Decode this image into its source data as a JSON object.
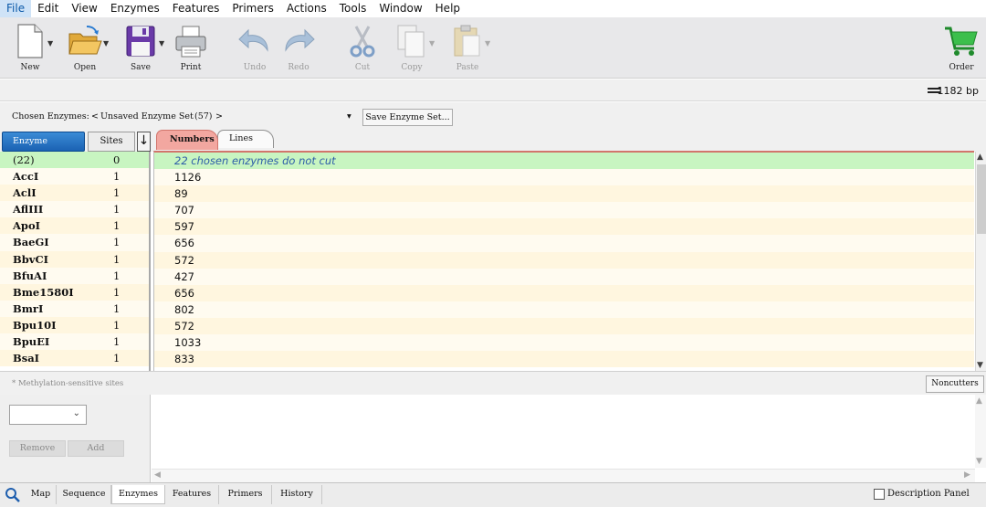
{
  "menu": {
    "items": [
      "File",
      "Edit",
      "View",
      "Enzymes",
      "Features",
      "Primers",
      "Actions",
      "Tools",
      "Window",
      "Help"
    ]
  },
  "toolbar": {
    "new": "New",
    "open": "Open",
    "save": "Save",
    "print": "Print",
    "undo": "Undo",
    "redo": "Redo",
    "cut": "Cut",
    "copy": "Copy",
    "paste": "Paste",
    "order": "Order"
  },
  "sequence": {
    "length": "1182 bp"
  },
  "enzyme_set": {
    "label": "Chosen Enzymes:",
    "prev": "<",
    "name": "Unsaved Enzyme Set",
    "count": "(57)",
    "next": ">",
    "dropdown": "▾",
    "save_button": "Save Enzyme Set..."
  },
  "columns": {
    "enzyme": "Enzyme",
    "sites": "Sites",
    "sort": "↓",
    "tab_numbers": "Numbers",
    "tab_lines": "Lines"
  },
  "enzymes": [
    {
      "name": "(22)",
      "sites": "0",
      "positions": "22 chosen enzymes do not cut"
    },
    {
      "name": "AccI",
      "sites": "1",
      "positions": "1126"
    },
    {
      "name": "AclI",
      "sites": "1",
      "positions": "89"
    },
    {
      "name": "AflIII",
      "sites": "1",
      "positions": "707"
    },
    {
      "name": "ApoI",
      "sites": "1",
      "positions": "597"
    },
    {
      "name": "BaeGI",
      "sites": "1",
      "positions": "656"
    },
    {
      "name": "BbvCI",
      "sites": "1",
      "positions": "572"
    },
    {
      "name": "BfuAI",
      "sites": "1",
      "positions": "427"
    },
    {
      "name": "Bme1580I",
      "sites": "1",
      "positions": "656"
    },
    {
      "name": "BmrI",
      "sites": "1",
      "positions": "802"
    },
    {
      "name": "Bpu10I",
      "sites": "1",
      "positions": "572"
    },
    {
      "name": "BpuEI",
      "sites": "1",
      "positions": "1033"
    },
    {
      "name": "BsaI",
      "sites": "1",
      "positions": "833"
    }
  ],
  "status": {
    "methylation": "* Methylation-sensitive sites",
    "noncutters": "Noncutters"
  },
  "lower": {
    "remove": "Remove",
    "add": "Add"
  },
  "bottom_tabs": [
    "Map",
    "Sequence",
    "Enzymes",
    "Features",
    "Primers",
    "History"
  ],
  "bottom_active": "Enzymes",
  "description_panel": "Description Panel",
  "colors": {
    "accent_blue": "#1b62b3",
    "numbers_tab": "#f2a7a0",
    "highlight_row": "#c8f5c1",
    "odd_row": "#fff6df"
  }
}
